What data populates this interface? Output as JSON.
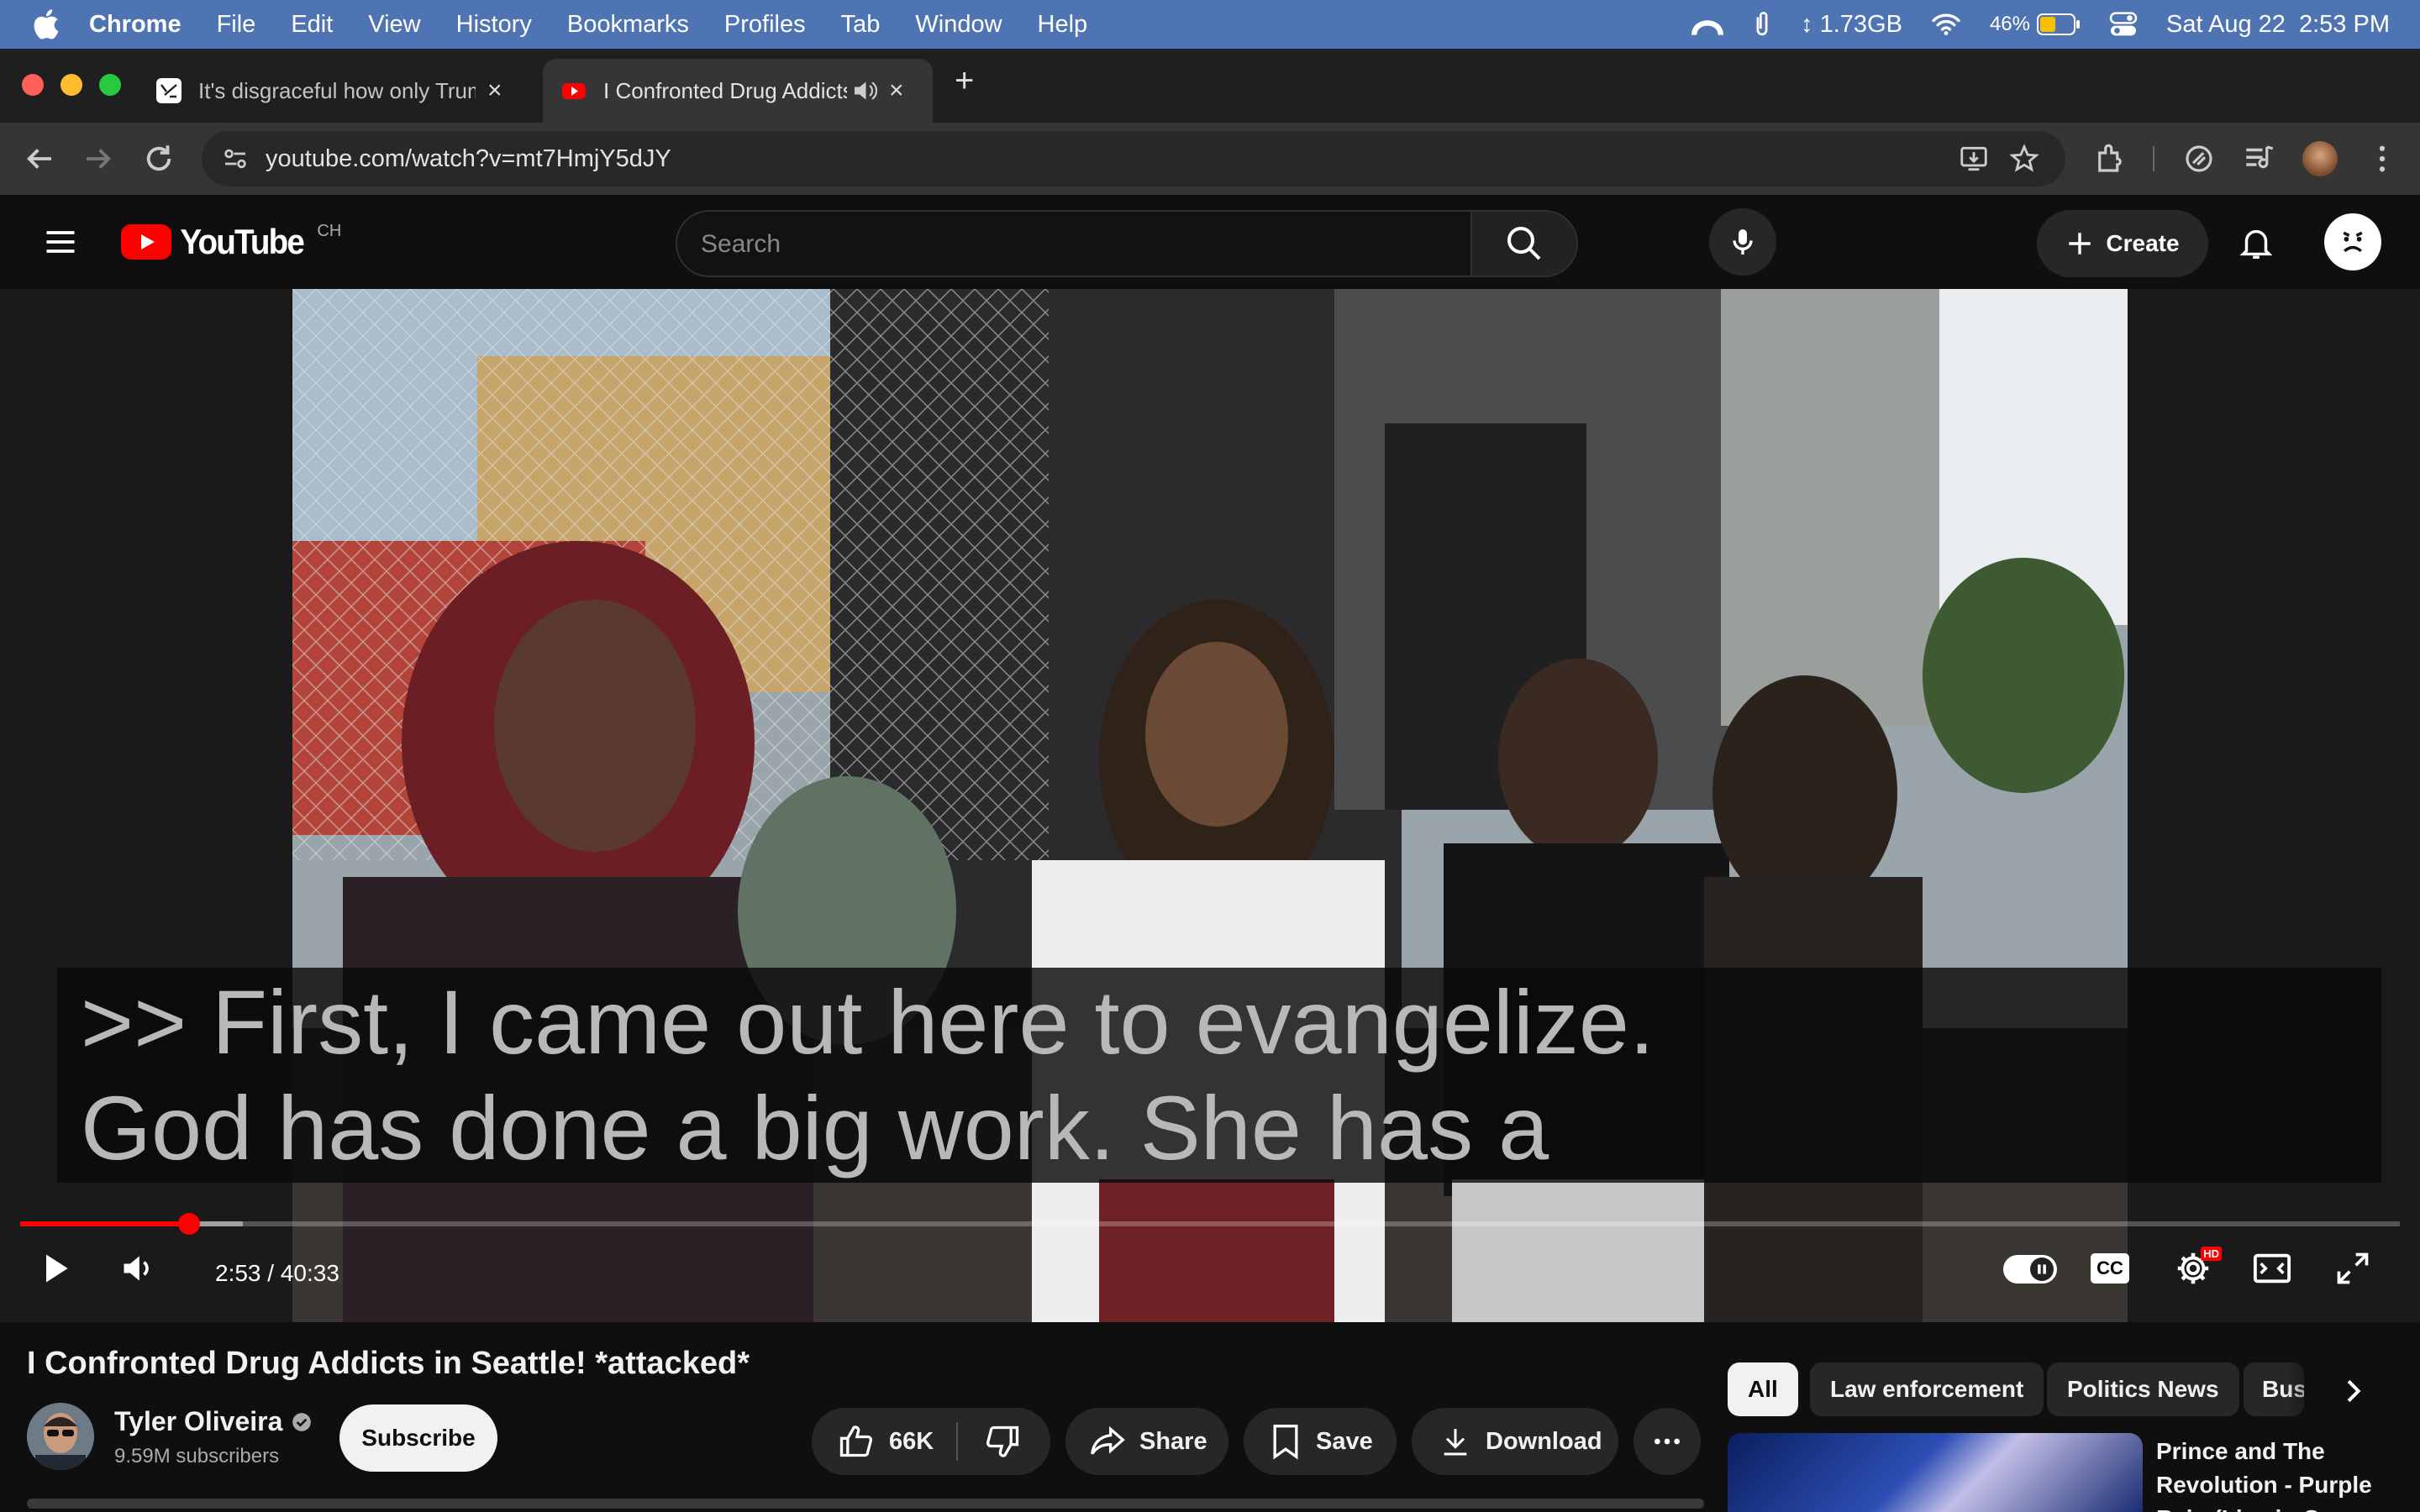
{
  "menubar": {
    "app": "Chrome",
    "items": [
      "File",
      "Edit",
      "View",
      "History",
      "Bookmarks",
      "Profiles",
      "Tab",
      "Window",
      "Help"
    ],
    "memory": "1.73GB",
    "battery": "46%",
    "datetime": "Sat Aug 22  2:53 PM"
  },
  "tabs": [
    {
      "title": "It's disgraceful how only Trum",
      "close": "×"
    },
    {
      "title": "I Confronted Drug Addicts",
      "close": "×"
    }
  ],
  "new_tab": "+",
  "toolbar": {
    "url": "youtube.com/watch?v=mt7HmjY5dJY"
  },
  "youtube": {
    "logo_text": "YouTube",
    "region": "CH",
    "search_placeholder": "Search",
    "create_label": "Create"
  },
  "player": {
    "caption_line1": ">> First, I came out here to evangelize.",
    "caption_line2": "God has done a big work. She has a",
    "time": "2:53 / 40:33",
    "progress_fraction": 0.0711,
    "cc_label": "CC",
    "hd_badge": "HD"
  },
  "video": {
    "title": "I Confronted Drug Addicts in Seattle! *attacked*",
    "channel": "Tyler Oliveira",
    "subscribers": "9.59M subscribers",
    "subscribe_label": "Subscribe",
    "likes": "66K",
    "share_label": "Share",
    "save_label": "Save",
    "download_label": "Download"
  },
  "chips": [
    "All",
    "Law enforcement",
    "Politics News",
    "Bus"
  ],
  "recommendation": {
    "title": "Prince and The Revolution - Purple Rain (Live in C"
  },
  "colors": {
    "menubar": "#4f74b3",
    "progress": "#ff0000",
    "youtube_red": "#ff0000"
  }
}
